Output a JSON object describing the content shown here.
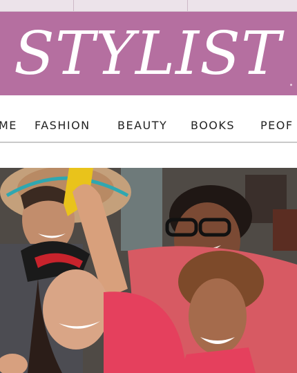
{
  "site": {
    "logo_text": "STYLIST",
    "brand_color": "#b56fa0"
  },
  "nav": {
    "items": [
      {
        "label": "ME",
        "name": "nav-item-home"
      },
      {
        "label": "FASHION",
        "name": "nav-item-fashion"
      },
      {
        "label": "BEAUTY",
        "name": "nav-item-beauty"
      },
      {
        "label": "BOOKS",
        "name": "nav-item-books"
      },
      {
        "label": "PEOF",
        "name": "nav-item-people"
      }
    ]
  },
  "hero": {
    "image": "party-photo"
  }
}
